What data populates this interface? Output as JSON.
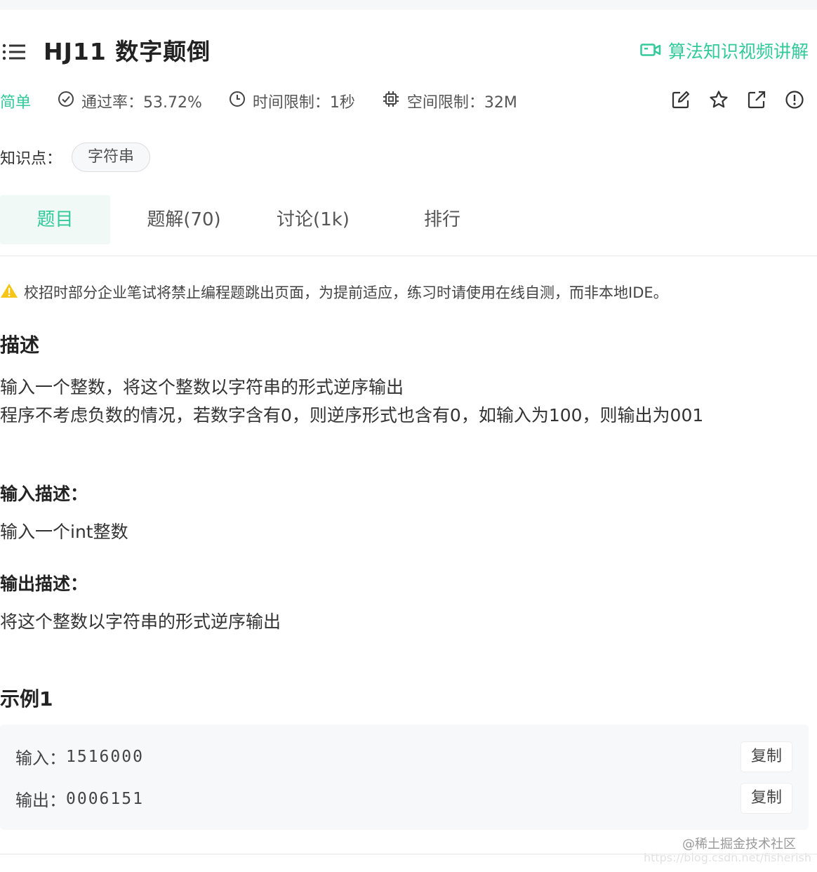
{
  "header": {
    "title": "HJ11  数字颠倒",
    "video_link": "算法知识视频讲解"
  },
  "meta": {
    "difficulty": "简单",
    "pass_rate": "通过率：53.72%",
    "time_limit": "时间限制：1秒",
    "memory_limit": "空间限制：32M",
    "actions": [
      "edit-icon",
      "star-icon",
      "share-icon",
      "report-icon"
    ]
  },
  "knowledge": {
    "label": "知识点：",
    "tags": [
      "字符串"
    ]
  },
  "tabs": [
    {
      "label": "题目",
      "active": true
    },
    {
      "label": "题解(70)",
      "active": false
    },
    {
      "label": "讨论(1k)",
      "active": false
    },
    {
      "label": "排行",
      "active": false
    }
  ],
  "notice": "校招时部分企业笔试将禁止编程题跳出页面，为提前适应，练习时请使用在线自测，而非本地IDE。",
  "description": {
    "heading": "描述",
    "lines": [
      "输入一个整数，将这个整数以字符串的形式逆序输出",
      "程序不考虑负数的情况，若数字含有0，则逆序形式也含有0，如输入为100，则输出为001"
    ]
  },
  "input_desc": {
    "heading": "输入描述：",
    "text": "输入一个int整数"
  },
  "output_desc": {
    "heading": "输出描述：",
    "text": "将这个整数以字符串的形式逆序输出"
  },
  "example": {
    "heading": "示例1",
    "input_label": "输入：",
    "input_value": "1516000",
    "output_label": "输出：",
    "output_value": "0006151",
    "copy_label": "复制"
  },
  "watermark": {
    "line1": "@稀土掘金技术社区",
    "line2": "https://blog.csdn.net/fisherish"
  },
  "colors": {
    "accent": "#32ca99",
    "warning": "#f5c518"
  }
}
